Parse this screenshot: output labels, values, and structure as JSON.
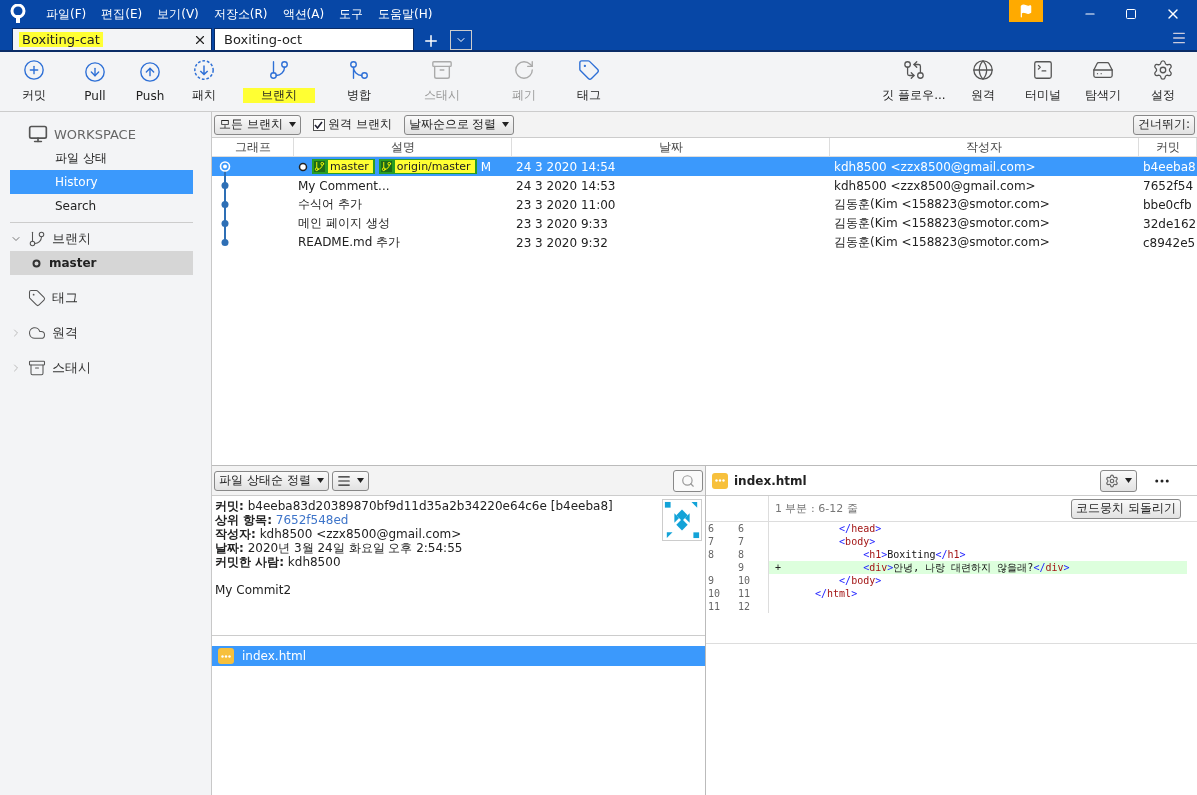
{
  "menu": [
    "파일(F)",
    "편집(E)",
    "보기(V)",
    "저장소(R)",
    "액션(A)",
    "도구",
    "도움말(H)"
  ],
  "tabs": [
    {
      "label": "Boxiting-cat",
      "selected": true,
      "highlighted": true
    },
    {
      "label": "Boxiting-oct",
      "selected": false,
      "highlighted": false
    }
  ],
  "toolbar_left": [
    {
      "label": "커밋",
      "disabled": false,
      "highlighted": false
    },
    {
      "label": "Pull",
      "disabled": false,
      "highlighted": false
    },
    {
      "label": "Push",
      "disabled": false,
      "highlighted": false
    },
    {
      "label": "패치",
      "disabled": false,
      "highlighted": false
    },
    {
      "label": "브랜치",
      "disabled": false,
      "highlighted": true
    },
    {
      "label": "병합",
      "disabled": false,
      "highlighted": false
    },
    {
      "label": "스태시",
      "disabled": true,
      "highlighted": false
    },
    {
      "label": "폐기",
      "disabled": true,
      "highlighted": false
    },
    {
      "label": "태그",
      "disabled": false,
      "highlighted": false
    }
  ],
  "toolbar_right": [
    {
      "label": "깃 플로우..."
    },
    {
      "label": "원격"
    },
    {
      "label": "터미널"
    },
    {
      "label": "탐색기"
    },
    {
      "label": "설정"
    }
  ],
  "sidebar": {
    "workspace": {
      "title": "WORKSPACE",
      "items": [
        {
          "label": "파일 상태",
          "selected": false
        },
        {
          "label": "History",
          "selected": true
        },
        {
          "label": "Search",
          "selected": false
        }
      ]
    },
    "sections": [
      {
        "label": "브랜치",
        "expanded": true,
        "children": [
          {
            "label": "master",
            "selected": true
          }
        ]
      },
      {
        "label": "태그"
      },
      {
        "label": "원격",
        "expanded": false
      },
      {
        "label": "스태시",
        "expanded": false
      }
    ]
  },
  "filters": {
    "branches": "모든 브랜치",
    "remote": {
      "label": "원격 브랜치",
      "checked": true
    },
    "sort": "날짜순으로 정렬",
    "jump": "건너뛰기:"
  },
  "table": {
    "columns": [
      "그래프",
      "설명",
      "날짜",
      "작성자",
      "커밋"
    ],
    "rows": [
      {
        "selected": true,
        "head": true,
        "refs": [
          {
            "label": "master",
            "highlighted": true
          },
          {
            "label": "origin/master",
            "highlighted": true
          }
        ],
        "description": "M",
        "date": "24 3 2020 14:54",
        "author": "kdh8500 <zzx8500@gmail.com>",
        "commit": "b4eeba8"
      },
      {
        "selected": false,
        "head": false,
        "description": "My Comment...",
        "date": "24 3 2020 14:53",
        "author": "kdh8500 <zzx8500@gmail.com>",
        "commit": "7652f54"
      },
      {
        "selected": false,
        "head": false,
        "description": "수식어 추가",
        "date": "23 3 2020 11:00",
        "author": "김동훈(Kim <158823@smotor.com>",
        "commit": "bbe0cfb"
      },
      {
        "selected": false,
        "head": false,
        "description": "메인 페이지 생성",
        "date": "23 3 2020 9:33",
        "author": "김동훈(Kim <158823@smotor.com>",
        "commit": "32de162"
      },
      {
        "selected": false,
        "head": false,
        "description": "README.md 추가",
        "date": "23 3 2020 9:32",
        "author": "김동훈(Kim <158823@smotor.com>",
        "commit": "c8942e5"
      }
    ]
  },
  "details": {
    "sort": "파일 상태순 정렬",
    "fields": [
      {
        "label": "커밋:",
        "value": "b4eeba83d20389870bf9d11d35a2b34220e64c6e [b4eeba8]",
        "link": false
      },
      {
        "label": "상위 항목:",
        "value": "7652f548ed",
        "link": true
      },
      {
        "label": "작성자:",
        "value": "kdh8500 <zzx8500@gmail.com>",
        "link": false
      },
      {
        "label": "날짜:",
        "value": "2020년 3월 24일 화요일 오후 2:54:55",
        "link": false
      },
      {
        "label": "커밋한 사람:",
        "value": "kdh8500",
        "link": false
      }
    ],
    "message": "My Commit2",
    "files": [
      {
        "name": "index.html",
        "selected": true
      }
    ]
  },
  "diff": {
    "file": "index.html",
    "hunk": "1 부분 : 6-12 줄",
    "revert": "코드뭉치 되돌리기",
    "lines": [
      {
        "old": "6",
        "new": "6",
        "added": false,
        "segments": [
          {
            "kind": "punct",
            "text": "    </"
          },
          {
            "kind": "name",
            "text": "head"
          },
          {
            "kind": "punct",
            "text": ">"
          }
        ]
      },
      {
        "old": "7",
        "new": "7",
        "added": false,
        "segments": [
          {
            "kind": "punct",
            "text": "    <"
          },
          {
            "kind": "name",
            "text": "body"
          },
          {
            "kind": "punct",
            "text": ">"
          }
        ]
      },
      {
        "old": "8",
        "new": "8",
        "added": false,
        "segments": [
          {
            "kind": "punct",
            "text": "        <"
          },
          {
            "kind": "name",
            "text": "h1"
          },
          {
            "kind": "punct",
            "text": ">"
          },
          {
            "kind": "text",
            "text": "Boxiting"
          },
          {
            "kind": "punct",
            "text": "</"
          },
          {
            "kind": "name",
            "text": "h1"
          },
          {
            "kind": "punct",
            "text": ">"
          }
        ]
      },
      {
        "new": "9",
        "added": true,
        "marker": "+",
        "segments": [
          {
            "kind": "punct",
            "text": "        <"
          },
          {
            "kind": "name",
            "text": "div"
          },
          {
            "kind": "punct",
            "text": ">"
          },
          {
            "kind": "text",
            "text": "안녕, 나랑 대련하지 않을래?"
          },
          {
            "kind": "punct",
            "text": "</"
          },
          {
            "kind": "name",
            "text": "div"
          },
          {
            "kind": "punct",
            "text": ">"
          }
        ]
      },
      {
        "old": "9",
        "new": "10",
        "added": false,
        "segments": [
          {
            "kind": "punct",
            "text": "    </"
          },
          {
            "kind": "name",
            "text": "body"
          },
          {
            "kind": "punct",
            "text": ">"
          }
        ]
      },
      {
        "old": "10",
        "new": "11",
        "added": false,
        "segments": [
          {
            "kind": "punct",
            "text": "</"
          },
          {
            "kind": "name",
            "text": "html"
          },
          {
            "kind": "punct",
            "text": ">"
          }
        ]
      },
      {
        "old": "11",
        "new": "12",
        "added": false
      }
    ]
  }
}
